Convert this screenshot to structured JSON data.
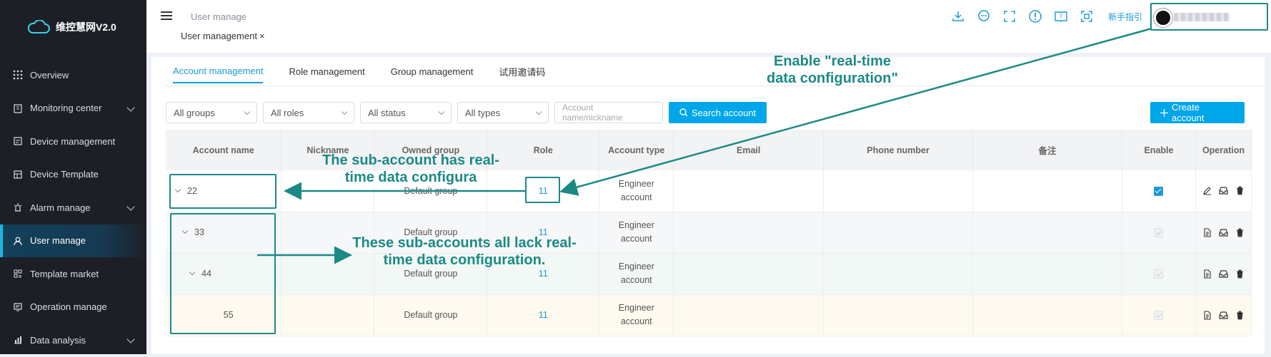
{
  "app": {
    "name": "维控慧网V2.0"
  },
  "sidebar": {
    "items": [
      {
        "label": "Overview",
        "icon": "grid-icon",
        "has_children": false,
        "active": false
      },
      {
        "label": "Monitoring center",
        "icon": "monitor-building-icon",
        "has_children": true,
        "active": false
      },
      {
        "label": "Device management",
        "icon": "device-icon",
        "has_children": false,
        "active": false
      },
      {
        "label": "Device Template",
        "icon": "template-icon",
        "has_children": false,
        "active": false
      },
      {
        "label": "Alarm manage",
        "icon": "alarm-icon",
        "has_children": true,
        "active": false
      },
      {
        "label": "User manage",
        "icon": "user-icon",
        "has_children": false,
        "active": true
      },
      {
        "label": "Template market",
        "icon": "market-icon",
        "has_children": false,
        "active": false
      },
      {
        "label": "Operation manage",
        "icon": "operation-icon",
        "has_children": false,
        "active": false
      },
      {
        "label": "Data analysis",
        "icon": "chart-icon",
        "has_children": true,
        "active": false
      }
    ]
  },
  "header": {
    "breadcrumb": "User manage",
    "page_tab": "User management",
    "page_tab_close": "×",
    "guide_label": "新手指引",
    "icons": [
      "download-icon",
      "chat-icon",
      "fullscreen-icon",
      "info-icon",
      "help-book-icon",
      "scan-icon"
    ]
  },
  "tabs": [
    {
      "label": "Account management",
      "active": true
    },
    {
      "label": "Role management",
      "active": false
    },
    {
      "label": "Group management",
      "active": false
    },
    {
      "label": "试用邀请码",
      "active": false
    }
  ],
  "filters": {
    "groups": "All groups",
    "roles": "All roles",
    "status": "All status",
    "types": "All types",
    "search_placeholder": "Account name/nickname",
    "search_button": "Search account",
    "create_button": "Create account"
  },
  "table": {
    "columns": [
      "Account name",
      "Nickname",
      "Owned group",
      "Role",
      "Account type",
      "Email",
      "Phone number",
      "备注",
      "Enable",
      "Operation"
    ],
    "rows": [
      {
        "name": "22",
        "nickname": "",
        "group": "Default group",
        "role": "11",
        "type": "Engineer account",
        "email": "",
        "phone": "",
        "remark": "",
        "enabled": true,
        "expandable": true
      },
      {
        "name": "33",
        "nickname": "",
        "group": "Default group",
        "role": "11",
        "type": "Engineer account",
        "email": "",
        "phone": "",
        "remark": "",
        "enabled": false,
        "expandable": true
      },
      {
        "name": "44",
        "nickname": "",
        "group": "Default group",
        "role": "11",
        "type": "Engineer account",
        "email": "",
        "phone": "",
        "remark": "",
        "enabled": false,
        "expandable": true
      },
      {
        "name": "55",
        "nickname": "",
        "group": "Default group",
        "role": "11",
        "type": "Engineer account",
        "email": "",
        "phone": "",
        "remark": "",
        "enabled": false,
        "expandable": false
      }
    ]
  },
  "annotations": {
    "enable": "Enable \"real-time data configuration\"",
    "has": "The sub-account has real-time data configura",
    "lack": "These sub-accounts all lack real-time data configuration.",
    "color": "#1b8a86"
  }
}
